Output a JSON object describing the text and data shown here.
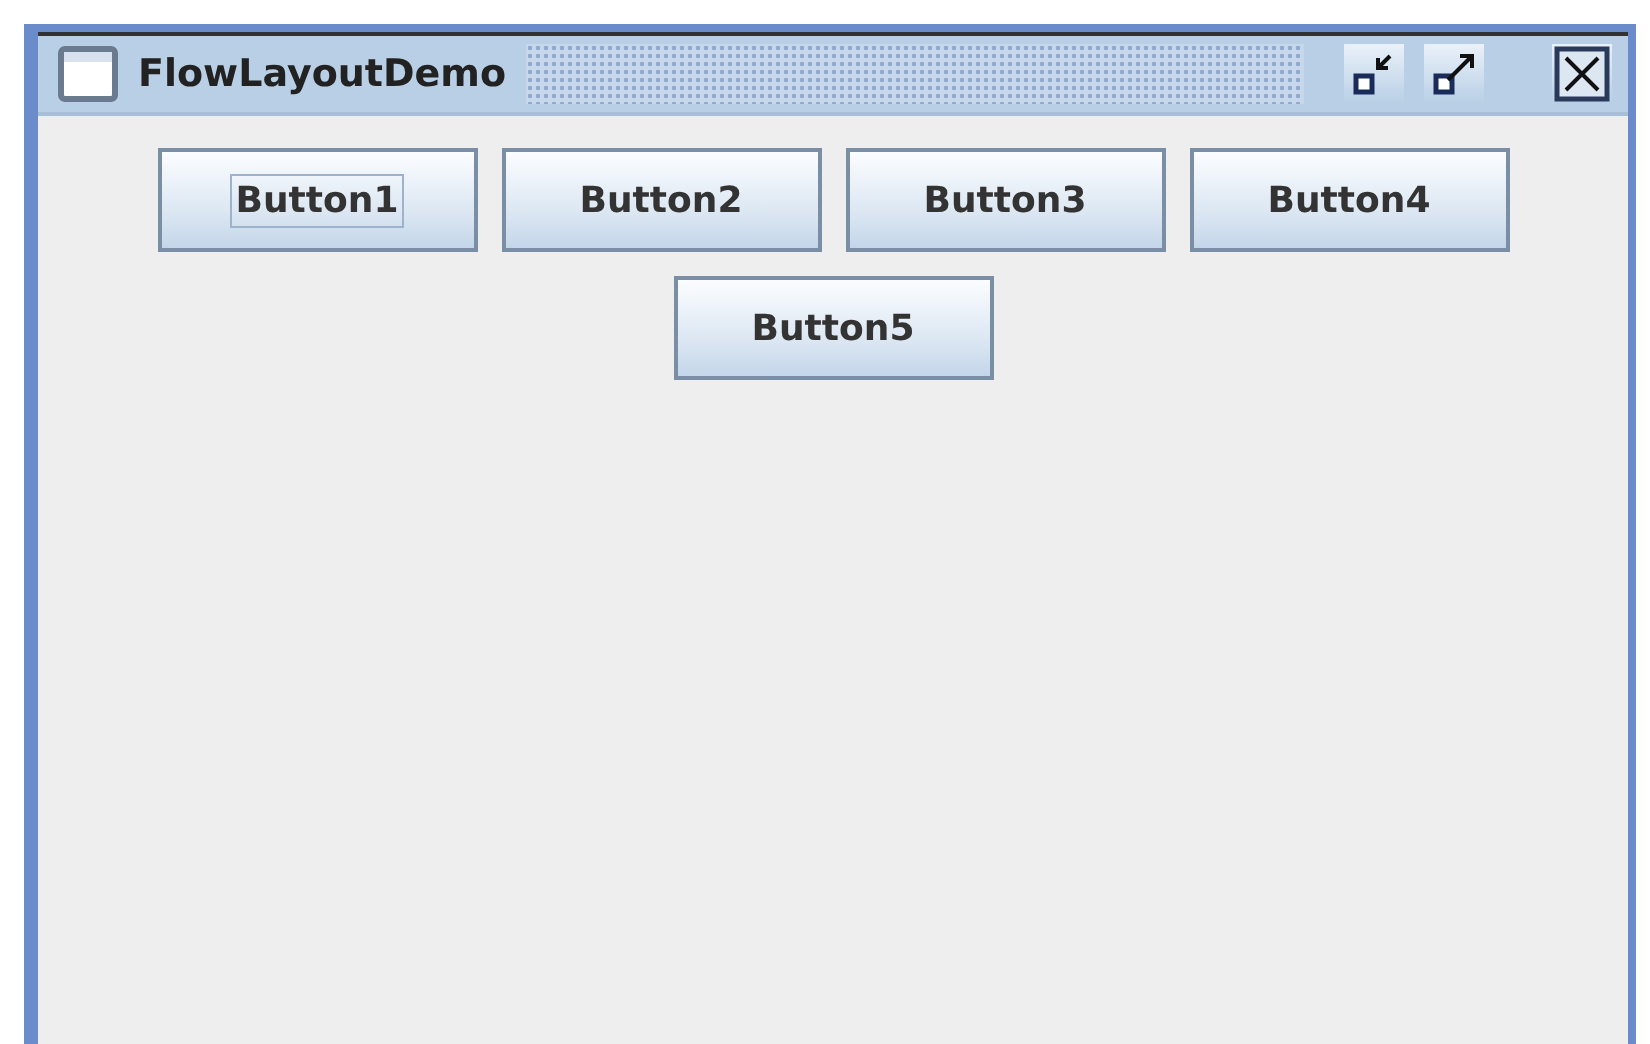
{
  "window": {
    "title": "FlowLayoutDemo"
  },
  "buttons": [
    {
      "label": "Button1",
      "focused": true
    },
    {
      "label": "Button2",
      "focused": false
    },
    {
      "label": "Button3",
      "focused": false
    },
    {
      "label": "Button4",
      "focused": false
    },
    {
      "label": "Button5",
      "focused": false
    }
  ]
}
